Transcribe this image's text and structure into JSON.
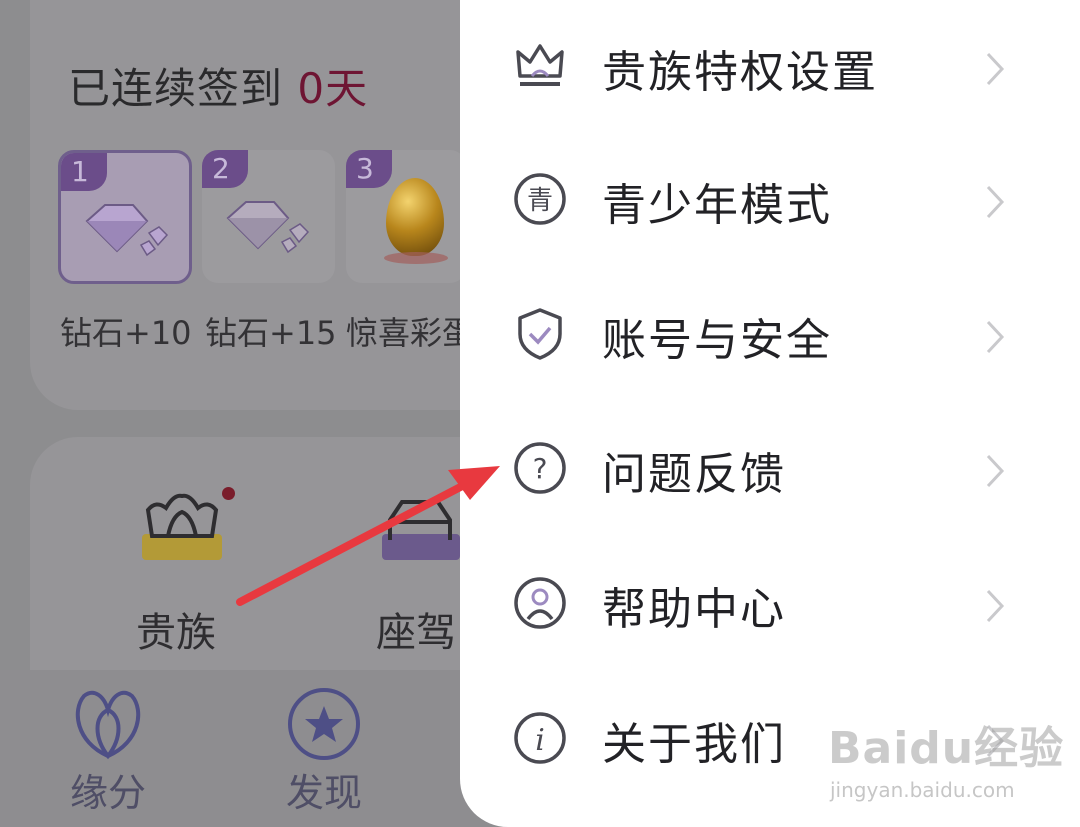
{
  "checkin": {
    "title_prefix": "已连续签到",
    "days": "0天",
    "rewards": [
      {
        "num": "1",
        "label": "钻石+10",
        "icon": "diamond-icon"
      },
      {
        "num": "2",
        "label": "钻石+15",
        "icon": "diamond-icon"
      },
      {
        "num": "3",
        "label": "惊喜彩蛋",
        "icon": "golden-egg-icon"
      }
    ]
  },
  "features": [
    {
      "label": "贵族",
      "icon": "crown-icon"
    },
    {
      "label": "座驾",
      "icon": "car-icon"
    }
  ],
  "bottom_nav": [
    {
      "label": "缘分",
      "icon": "heart-petal-icon"
    },
    {
      "label": "发现",
      "icon": "star-circle-icon"
    }
  ],
  "menu": [
    {
      "label": "贵族特权设置",
      "icon": "crown-icon"
    },
    {
      "label": "青少年模式",
      "icon": "youth-mode-icon"
    },
    {
      "label": "账号与安全",
      "icon": "shield-check-icon"
    },
    {
      "label": "问题反馈",
      "icon": "question-icon"
    },
    {
      "label": "帮助中心",
      "icon": "help-person-icon"
    },
    {
      "label": "关于我们",
      "icon": "info-icon"
    }
  ],
  "watermark": {
    "main": "Baidu经验",
    "sub": "jingyan.baidu.com"
  },
  "colors": {
    "days_red": "#6e1533",
    "arrow_red": "#e8393f",
    "accent_purple": "#6b4d8a"
  }
}
